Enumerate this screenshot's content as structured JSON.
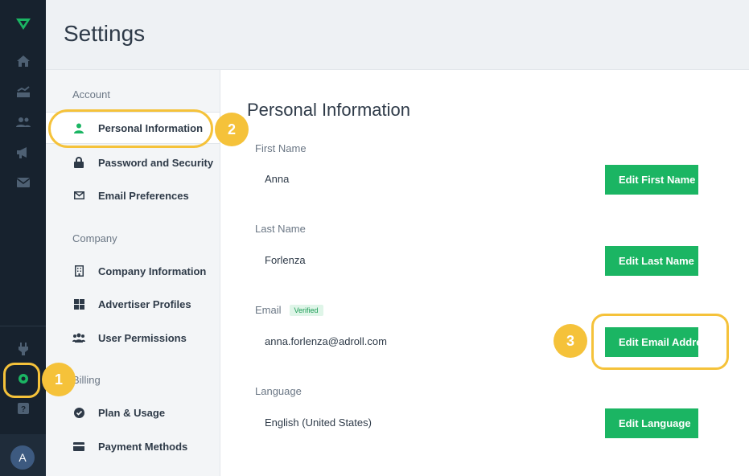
{
  "rail": {
    "items": [
      "logo-icon",
      "home-icon",
      "analytics-icon",
      "audiences-icon",
      "campaigns-icon",
      "email-icon"
    ],
    "bottom_items": [
      "integrations-icon",
      "settings-icon",
      "help-icon"
    ],
    "avatar_initial": "A"
  },
  "header": {
    "title": "Settings"
  },
  "subnav": {
    "sections": [
      {
        "label": "Account",
        "items": [
          "Personal Information",
          "Password and Security",
          "Email Preferences"
        ]
      },
      {
        "label": "Company",
        "items": [
          "Company Information",
          "Advertiser Profiles",
          "User Permissions"
        ]
      },
      {
        "label": "Billing",
        "items": [
          "Plan & Usage",
          "Payment Methods"
        ]
      }
    ],
    "active": "Personal Information"
  },
  "main": {
    "title": "Personal Information",
    "fields": [
      {
        "label": "First Name",
        "value": "Anna",
        "button": "Edit First Name"
      },
      {
        "label": "Last Name",
        "value": "Forlenza",
        "button": "Edit Last Name"
      },
      {
        "label": "Email",
        "badge": "Verified",
        "value": "anna.forlenza@adroll.com",
        "button": "Edit Email Address"
      },
      {
        "label": "Language",
        "value": "English (United States)",
        "button": "Edit Language"
      }
    ]
  },
  "callouts": [
    "1",
    "2",
    "3"
  ],
  "colors": {
    "accent": "#1bb563",
    "highlight": "#f5c23a",
    "rail": "#17222e"
  }
}
